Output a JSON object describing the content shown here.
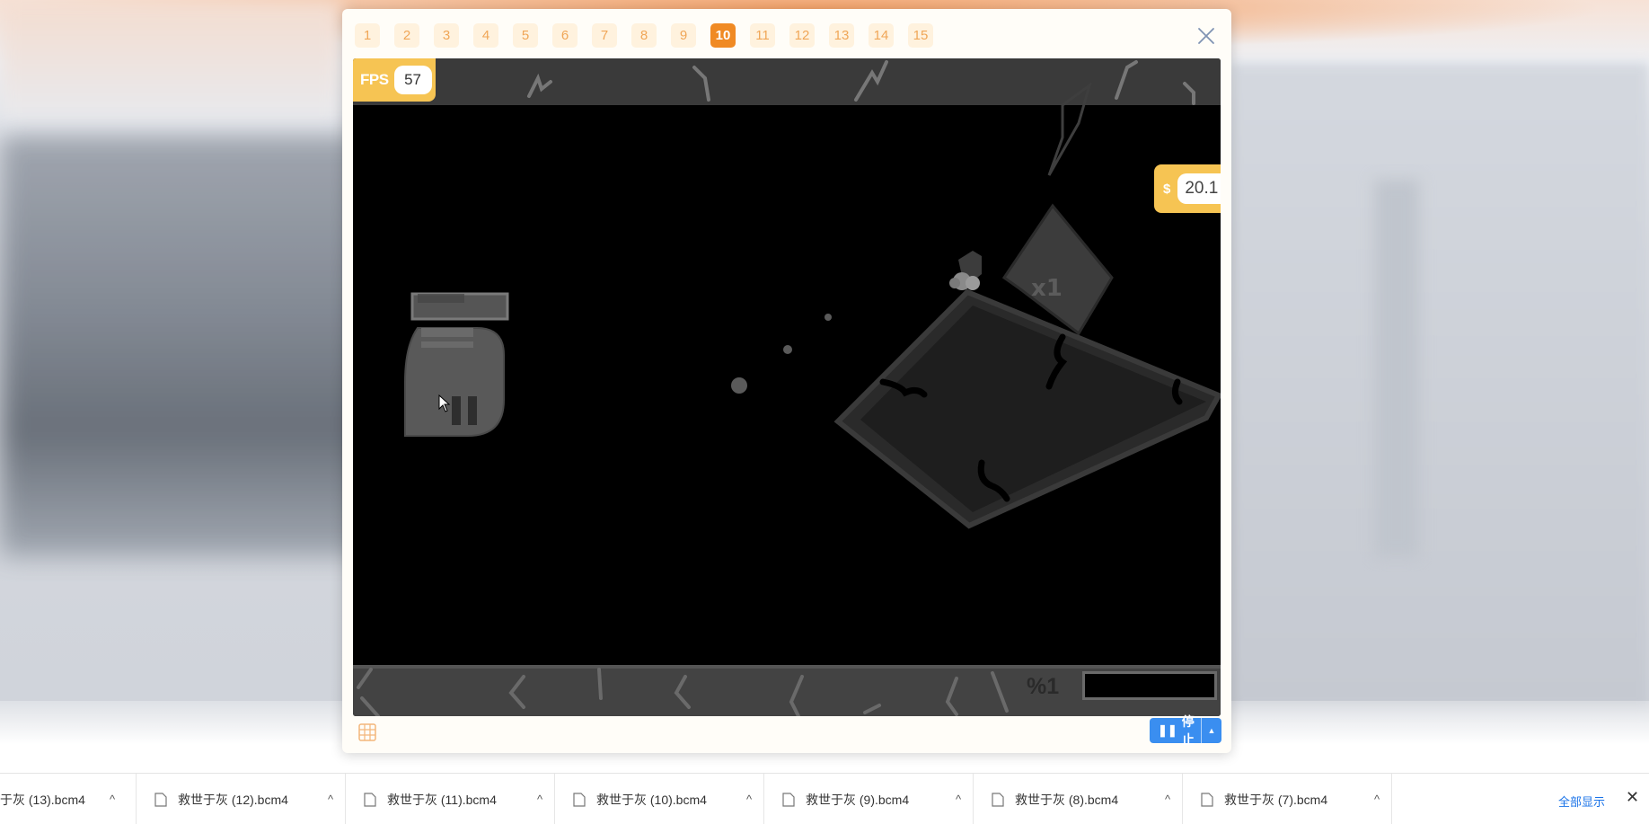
{
  "dialog": {
    "tabs": [
      "1",
      "2",
      "3",
      "4",
      "5",
      "6",
      "7",
      "8",
      "9",
      "10",
      "11",
      "12",
      "13",
      "14",
      "15"
    ],
    "active_tab": "10"
  },
  "game": {
    "fps_label": "FPS",
    "fps_value": "57",
    "money_label": "$",
    "money_value": "20.1",
    "progress_label": "%1",
    "enemy_label": "x1"
  },
  "controls": {
    "stop_label": "停止",
    "stop_glyph": "❚❚",
    "stop_arrow": "▲"
  },
  "downloads": {
    "items": [
      {
        "name": "于灰 (13).bcm4"
      },
      {
        "name": "救世于灰 (12).bcm4"
      },
      {
        "name": "救世于灰 (11).bcm4"
      },
      {
        "name": "救世于灰 (10).bcm4"
      },
      {
        "name": "救世于灰 (9).bcm4"
      },
      {
        "name": "救世于灰 (8).bcm4"
      },
      {
        "name": "救世于灰 (7).bcm4"
      }
    ],
    "caret": "^",
    "show_all": "全部显示",
    "close": "✕"
  },
  "colors": {
    "accent_orange": "#f08a24",
    "tab_bg": "#fff2de",
    "badge_yellow": "#f6c453",
    "button_blue": "#3a8ef0"
  }
}
